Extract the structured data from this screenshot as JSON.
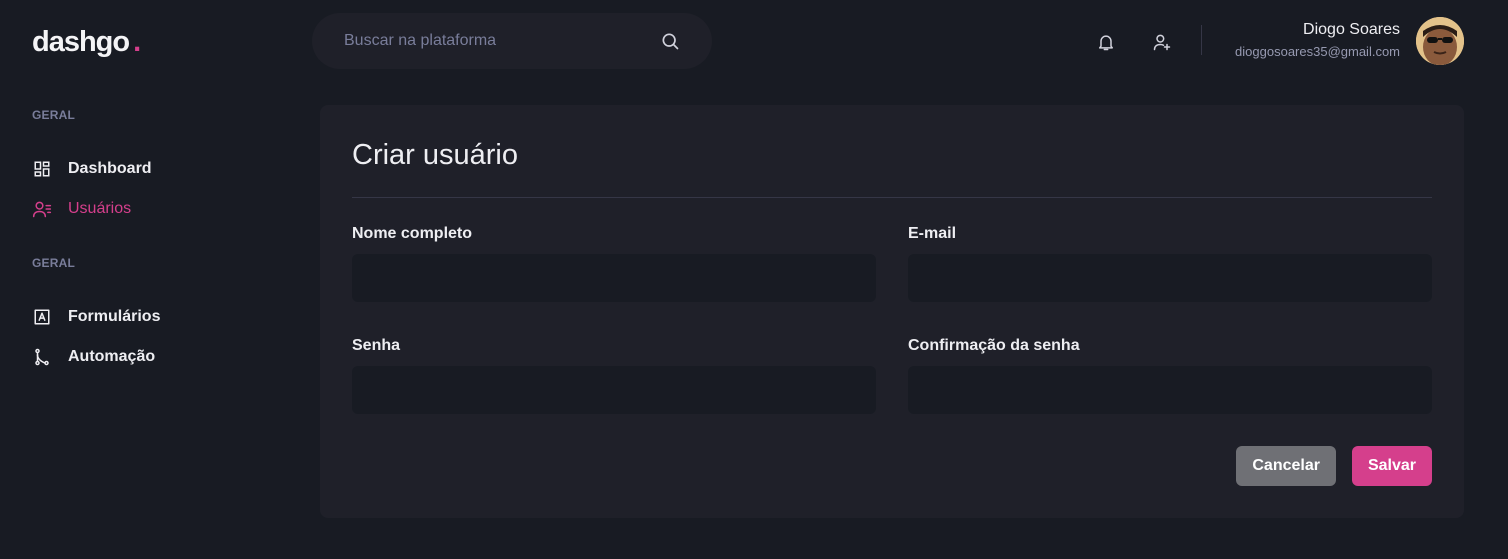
{
  "brand": {
    "name": "dashgo",
    "dot": ".",
    "accent_color": "#d53f8c"
  },
  "search": {
    "placeholder": "Buscar na plataforma",
    "icon": "search-icon"
  },
  "header": {
    "icons": [
      "bell-icon",
      "user-plus-icon"
    ],
    "user": {
      "name": "Diogo Soares",
      "email": "dioggosoares35@gmail.com"
    }
  },
  "sidebar": {
    "sections": [
      {
        "title": "GERAL",
        "items": [
          {
            "label": "Dashboard",
            "icon": "dashboard-icon",
            "active": false
          },
          {
            "label": "Usuários",
            "icon": "users-icon",
            "active": true
          }
        ]
      },
      {
        "title": "GERAL",
        "items": [
          {
            "label": "Formulários",
            "icon": "form-icon",
            "active": false
          },
          {
            "label": "Automação",
            "icon": "automation-icon",
            "active": false
          }
        ]
      }
    ]
  },
  "form": {
    "title": "Criar usuário",
    "fields": {
      "name": {
        "label": "Nome completo",
        "value": ""
      },
      "email": {
        "label": "E-mail",
        "value": ""
      },
      "password": {
        "label": "Senha",
        "value": ""
      },
      "password_confirmation": {
        "label": "Confirmação da senha",
        "value": ""
      }
    },
    "cancel_label": "Cancelar",
    "save_label": "Salvar"
  }
}
